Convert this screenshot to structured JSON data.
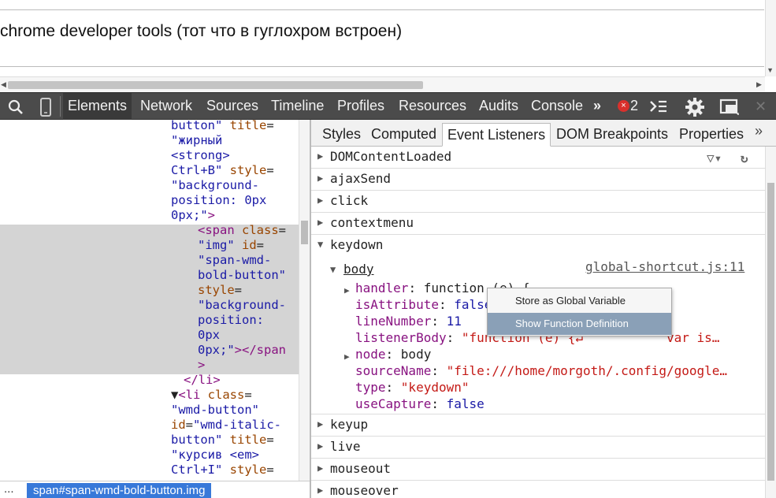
{
  "page": {
    "heading": "chrome developer tools (тот что в гуглохром встроен)"
  },
  "toolbar": {
    "search_icon": "search-icon",
    "device_icon": "device-mode-icon",
    "tabs": [
      "Elements",
      "Network",
      "Sources",
      "Timeline",
      "Profiles",
      "Resources",
      "Audits",
      "Console"
    ],
    "active_tab": "Elements",
    "overflow": "»",
    "error_count": "2",
    "error_badge": "×"
  },
  "elements_pane": {
    "lines": [
      {
        "text": "button\" title=",
        "parts": [
          [
            "av",
            "button\""
          ],
          [
            "at",
            " title"
          ],
          [
            "pp",
            "="
          ]
        ]
      },
      {
        "parts": [
          [
            "av",
            "\"жирный"
          ]
        ]
      },
      {
        "parts": [
          [
            "av",
            "<strong>"
          ]
        ]
      },
      {
        "parts": [
          [
            "av",
            "Ctrl+B\""
          ],
          [
            "at",
            " style"
          ],
          [
            "pp",
            "="
          ]
        ]
      },
      {
        "parts": [
          [
            "av",
            "\"background-"
          ]
        ]
      },
      {
        "parts": [
          [
            "av",
            "position: 0px"
          ]
        ]
      },
      {
        "parts": [
          [
            "av",
            "0px;\""
          ],
          [
            "tg",
            ">"
          ]
        ]
      },
      {
        "parts": [
          [
            "tg",
            "<span"
          ],
          [
            "at",
            " class"
          ],
          [
            "pp",
            "="
          ]
        ]
      },
      {
        "parts": [
          [
            "av",
            "\"img\""
          ],
          [
            "at",
            " id"
          ],
          [
            "pp",
            "="
          ]
        ]
      },
      {
        "parts": [
          [
            "av",
            "\"span-wmd-"
          ]
        ]
      },
      {
        "parts": [
          [
            "av",
            "bold-button\""
          ]
        ]
      },
      {
        "parts": [
          [
            "at",
            "style"
          ],
          [
            "pp",
            "="
          ]
        ]
      },
      {
        "parts": [
          [
            "av",
            "\"background-"
          ]
        ]
      },
      {
        "parts": [
          [
            "av",
            "position:"
          ]
        ]
      },
      {
        "parts": [
          [
            "av",
            "0px"
          ]
        ]
      },
      {
        "parts": [
          [
            "av",
            "0px;\""
          ],
          [
            "tg",
            "></span"
          ]
        ]
      },
      {
        "parts": [
          [
            "tg",
            ">"
          ]
        ]
      },
      {
        "parts": [
          [
            "tg",
            "</li>"
          ]
        ]
      },
      {
        "parts": [
          [
            "pp",
            "▼"
          ],
          [
            "tg",
            "<li"
          ],
          [
            "at",
            " class"
          ],
          [
            "pp",
            "="
          ]
        ]
      },
      {
        "parts": [
          [
            "av",
            "\"wmd-button\""
          ]
        ]
      },
      {
        "parts": [
          [
            "at",
            "id"
          ],
          [
            "pp",
            "="
          ],
          [
            "av",
            "\"wmd-italic-"
          ]
        ]
      },
      {
        "parts": [
          [
            "av",
            "button\""
          ],
          [
            "at",
            " title"
          ],
          [
            "pp",
            "="
          ]
        ]
      },
      {
        "parts": [
          [
            "av",
            "\"курсив <em>"
          ]
        ]
      },
      {
        "parts": [
          [
            "av",
            "Ctrl+I\""
          ],
          [
            "at",
            " style"
          ],
          [
            "pp",
            "="
          ]
        ]
      }
    ],
    "breadcrumb_more": "...",
    "breadcrumb_selected": "span#span-wmd-bold-button.img"
  },
  "sidebar": {
    "tabs": [
      "Styles",
      "Computed",
      "Event Listeners",
      "DOM Breakpoints",
      "Properties"
    ],
    "active_tab": "Event Listeners",
    "overflow": "»",
    "filter_icon": "▽▾",
    "refresh_icon": "↻",
    "events_before": [
      "DOMContentLoaded",
      "ajaxSend",
      "click",
      "contextmenu"
    ],
    "expanded_event": "keydown",
    "node_label": "body",
    "source_link": "global-shortcut.js:11",
    "properties": [
      {
        "key": "handler",
        "value": "function (e) {",
        "vclass": "pp",
        "expandable": true
      },
      {
        "key": "isAttribute",
        "value": "false",
        "vclass": "pn",
        "expandable": false
      },
      {
        "key": "lineNumber",
        "value": "11",
        "vclass": "pn",
        "expandable": false
      },
      {
        "key": "listenerBody",
        "value": "\"function (e) {↵           var is…",
        "vclass": "ps",
        "expandable": false
      },
      {
        "key": "node",
        "value": "body",
        "vclass": "pp",
        "expandable": true
      },
      {
        "key": "sourceName",
        "value": "\"file:///home/morgoth/.config/google…",
        "vclass": "ps",
        "expandable": false
      },
      {
        "key": "type",
        "value": "\"keydown\"",
        "vclass": "ps",
        "expandable": false
      },
      {
        "key": "useCapture",
        "value": "false",
        "vclass": "pn",
        "expandable": false
      }
    ],
    "events_after": [
      "keyup",
      "live",
      "mouseout",
      "mouseover"
    ]
  },
  "context_menu": {
    "items": [
      "Store as Global Variable",
      "Show Function Definition"
    ],
    "selected_index": 1
  }
}
